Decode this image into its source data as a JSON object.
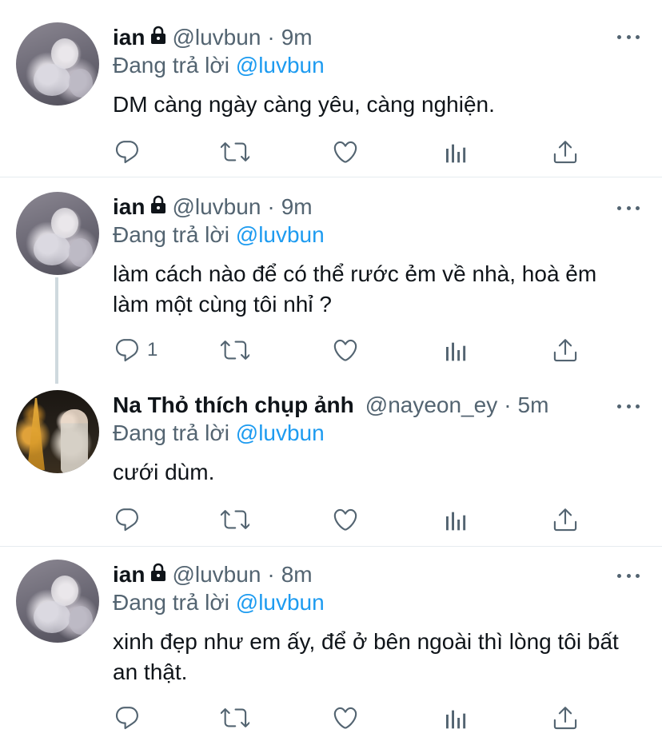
{
  "tweets": [
    {
      "name": "ian",
      "handle": "@luvbun",
      "time": "9m",
      "reply_prefix": "Đang trả lời",
      "reply_mention": "@luvbun",
      "text": "DM càng ngày càng yêu, càng nghiện.",
      "reply_count": "",
      "protected": true
    },
    {
      "name": "ian",
      "handle": "@luvbun",
      "time": "9m",
      "reply_prefix": "Đang trả lời",
      "reply_mention": "@luvbun",
      "text": "làm cách nào để có thể rước ẻm về nhà, hoà ẻm làm một cùng tôi nhỉ ?",
      "reply_count": "1",
      "protected": true
    },
    {
      "name": "Na Thỏ thích chụp ảnh",
      "handle": "@nayeon_ey",
      "time": "5m",
      "reply_prefix": "Đang trả lời",
      "reply_mention": "@luvbun",
      "text": "cưới dùm.",
      "reply_count": "",
      "protected": false
    },
    {
      "name": "ian",
      "handle": "@luvbun",
      "time": "8m",
      "reply_prefix": "Đang trả lời",
      "reply_mention": "@luvbun",
      "text": "xinh đẹp như em ấy, để ở bên ngoài thì lòng tôi bất an thật.",
      "reply_count": "",
      "protected": true
    }
  ],
  "separator": "·",
  "icons": {
    "reply": "reply-icon",
    "retweet": "retweet-icon",
    "like": "heart-icon",
    "analytics": "analytics-icon",
    "share": "share-icon",
    "more": "more-icon",
    "lock": "lock-icon"
  },
  "colors": {
    "text": "#0f1419",
    "secondary": "#536471",
    "link": "#1d9bf0",
    "divider": "#e6ecf0"
  }
}
